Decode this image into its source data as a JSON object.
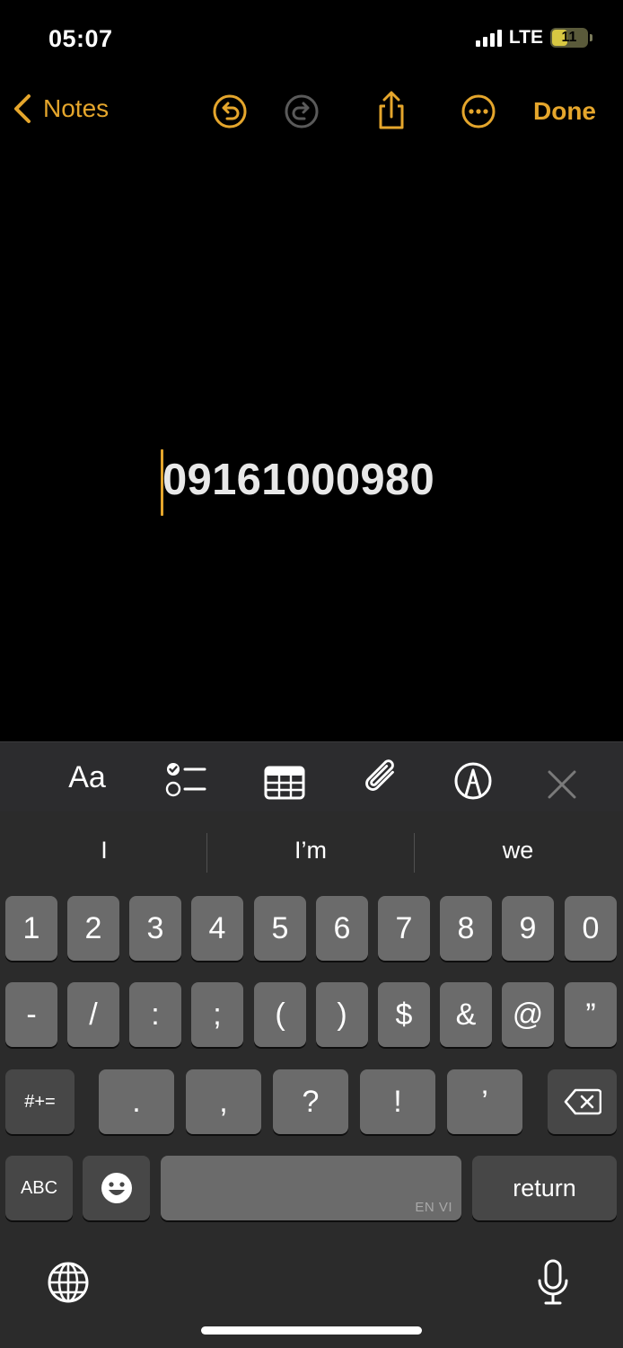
{
  "status": {
    "time": "05:07",
    "network": "LTE",
    "battery": "11",
    "battery_level": 0.11
  },
  "nav": {
    "back_label": "Notes",
    "done_label": "Done",
    "icons": [
      "undo-icon",
      "redo-icon",
      "share-icon",
      "more-icon"
    ]
  },
  "note": {
    "text": "09161000980"
  },
  "toolbar": {
    "format_label": "Aa",
    "icons": [
      "checklist-icon",
      "table-icon",
      "attachment-icon",
      "markup-icon",
      "close-icon"
    ]
  },
  "keyboard": {
    "suggestions": [
      "I",
      "I’m",
      "we"
    ],
    "row1": [
      "1",
      "2",
      "3",
      "4",
      "5",
      "6",
      "7",
      "8",
      "9",
      "0"
    ],
    "row2": [
      "-",
      "/",
      ":",
      ";",
      "(",
      ")",
      "$",
      "&",
      "@",
      "”"
    ],
    "row3_left": "#+=",
    "row3": [
      ".",
      ",",
      "?",
      "!",
      "’"
    ],
    "abc_label": "ABC",
    "space_lang": "EN VI",
    "return_label": "return"
  },
  "colors": {
    "accent": "#e5a62c",
    "key": "#6b6b6b",
    "key_func": "#474747",
    "keyboard_bg": "#2b2b2b"
  }
}
